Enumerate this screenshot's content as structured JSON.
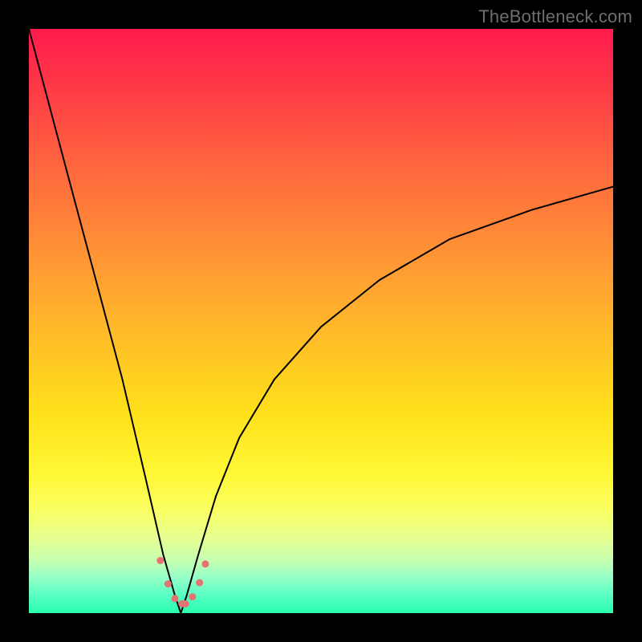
{
  "watermark": "TheBottleneck.com",
  "chart_data": {
    "type": "line",
    "title": "",
    "xlabel": "",
    "ylabel": "",
    "xlim": [
      0,
      100
    ],
    "ylim": [
      0,
      100
    ],
    "background_gradient": {
      "top": "#ff1a4d",
      "bottom": "#2bffb0",
      "meaning": "qualitative red→green mismatch scale"
    },
    "curve": {
      "description": "V-shaped bottleneck curve with minimum near x≈26; left branch steep from y≈100 to 0, right branch climbs slowly to y≈73 at x=100",
      "x": [
        0,
        4,
        8,
        12,
        16,
        20,
        23,
        25,
        26,
        27,
        29,
        32,
        36,
        42,
        50,
        60,
        72,
        86,
        100
      ],
      "y": [
        100,
        85,
        70,
        55,
        40,
        23,
        10,
        3,
        0,
        3,
        10,
        20,
        30,
        40,
        49,
        57,
        64,
        69,
        73
      ]
    },
    "markers": {
      "description": "pink dotted cluster near curve minimum",
      "x": [
        22.5,
        23.8,
        25.0,
        26.2,
        26.8,
        28.0,
        29.2,
        30.2
      ],
      "y": [
        9.0,
        5.0,
        2.5,
        1.6,
        1.6,
        2.8,
        5.2,
        8.4
      ],
      "color": "#e57373",
      "size": 9
    }
  }
}
